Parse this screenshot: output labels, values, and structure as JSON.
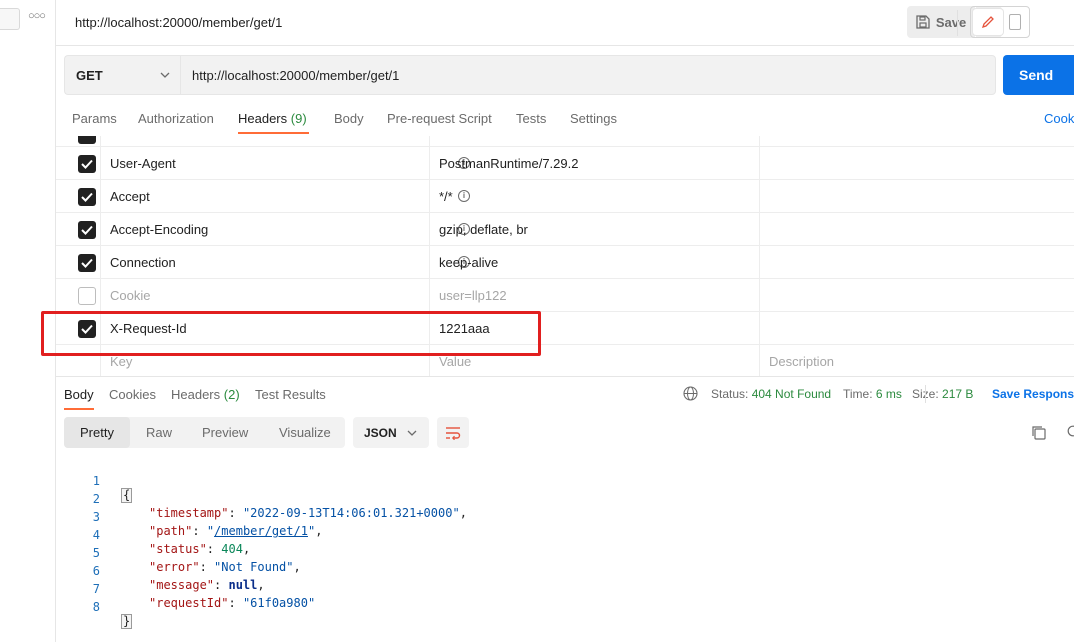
{
  "tab": {
    "title": "http://localhost:20000/member/get/1"
  },
  "toolbar": {
    "save_label": "Save"
  },
  "request": {
    "method": "GET",
    "url": "http://localhost:20000/member/get/1",
    "send_label": "Send"
  },
  "request_tabs": {
    "params": "Params",
    "authorization": "Authorization",
    "headers": "Headers",
    "headers_count": "(9)",
    "body": "Body",
    "prerequest": "Pre-request Script",
    "tests": "Tests",
    "settings": "Settings",
    "cookies": "Cook"
  },
  "headers": [
    {
      "key": "User-Agent",
      "value": "PostmanRuntime/7.29.2",
      "checked": true,
      "info": true
    },
    {
      "key": "Accept",
      "value": "*/*",
      "checked": true,
      "info": true
    },
    {
      "key": "Accept-Encoding",
      "value": "gzip, deflate, br",
      "checked": true,
      "info": true
    },
    {
      "key": "Connection",
      "value": "keep-alive",
      "checked": true,
      "info": true
    },
    {
      "key": "Cookie",
      "value": "user=llp122",
      "checked": false,
      "info": false
    },
    {
      "key": "X-Request-Id",
      "value": "1221aaa",
      "checked": true,
      "info": false
    }
  ],
  "headers_placeholders": {
    "key": "Key",
    "value": "Value",
    "description": "Description"
  },
  "response_tabs": {
    "body": "Body",
    "cookies": "Cookies",
    "headers": "Headers",
    "headers_count": "(2)",
    "test_results": "Test Results"
  },
  "response_meta": {
    "status_label": "Status:",
    "status_value": "404 Not Found",
    "time_label": "Time:",
    "time_value": "6 ms",
    "size_label": "Size:",
    "size_value": "217 B",
    "save_response": "Save Respons"
  },
  "view_modes": {
    "pretty": "Pretty",
    "raw": "Raw",
    "preview": "Preview",
    "visualize": "Visualize"
  },
  "format": "JSON",
  "body_lines": [
    {
      "n": "1"
    },
    {
      "n": "2",
      "key": "\"timestamp\"",
      "val": "\"2022-09-13T14:06:01.321+0000\""
    },
    {
      "n": "3",
      "key": "\"path\"",
      "val_pre": "\"",
      "val_link": "/member/get/1",
      "val_post": "\""
    },
    {
      "n": "4",
      "key": "\"status\"",
      "val": "404"
    },
    {
      "n": "5",
      "key": "\"error\"",
      "val": "\"Not Found\""
    },
    {
      "n": "6",
      "key": "\"message\"",
      "val": "null"
    },
    {
      "n": "7",
      "key": "\"requestId\"",
      "val": "\"61f0a980\""
    },
    {
      "n": "8"
    }
  ],
  "braces": {
    "open": "{",
    "close": "}"
  },
  "colors": {
    "accent": "#ff6c37",
    "send": "#0b72e7",
    "highlight": "#e11f1f",
    "status_error": "#2b8a3e"
  }
}
